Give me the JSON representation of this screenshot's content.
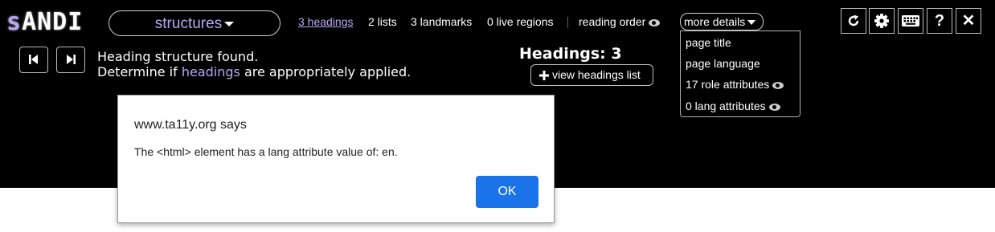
{
  "logo": {
    "s": "s",
    "rest": "ANDI"
  },
  "mode_selector": {
    "label": "structures"
  },
  "nav": {
    "headings": "3 headings",
    "lists": "2 lists",
    "landmarks": "3 landmarks",
    "live_regions": "0 live regions",
    "reading_order": "reading order",
    "more_details": "more details"
  },
  "more_details_menu": [
    "page title",
    "page language",
    "17 role attributes",
    "0 lang attributes"
  ],
  "toolbar": {
    "help": "?",
    "close": "✕"
  },
  "message": {
    "line1": "Heading structure found.",
    "line2_pre": "Determine if ",
    "line2_link": "headings",
    "line2_post": " are appropriately applied."
  },
  "headings_count": "Headings: 3",
  "view_headings_button": "view headings list",
  "dialog": {
    "title": "www.ta11y.org says",
    "message": "The <html> element has a lang attribute value of: en.",
    "ok": "OK"
  },
  "colors": {
    "accent": "#b8a6f3",
    "ok_button": "#1a73e8",
    "bar": "#000000"
  }
}
